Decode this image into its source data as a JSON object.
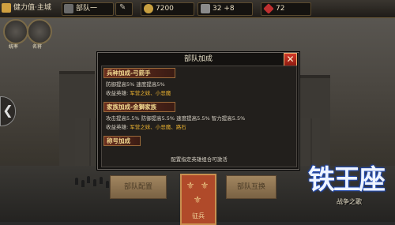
{
  "topbar": {
    "power_label": "健力值·主城",
    "unit_label": "部队一",
    "coins": "7200",
    "troops": "32",
    "troops_plus": "+8",
    "gems": "72"
  },
  "side": {
    "label_1": "统率",
    "label_2": "名将"
  },
  "modal": {
    "title": "部队加成",
    "close_glyph": "✕",
    "sections": [
      {
        "header": "兵种加成-弓箭手",
        "lines": [
          {
            "text": "防御提高5%  速度提高5%"
          },
          {
            "prefix": "收益英雄:",
            "heroes": "军营之妹、小恶魔"
          }
        ]
      },
      {
        "header": "家族加成-金獅家族",
        "lines": [
          {
            "text": "攻击提高5.5%  防御提高5.5%  速度提高5.5%  智力提高5.5%"
          },
          {
            "prefix": "收益英雄:",
            "heroes": "军营之妹、小恶魔、路石"
          }
        ]
      },
      {
        "header": "称号加成",
        "lines": []
      }
    ],
    "footer": "配置指定英雄组合可激活"
  },
  "buttons": {
    "left": "部队配置",
    "center": "征兵",
    "right": "部队互换"
  },
  "logo": {
    "title": "铁王座",
    "subtitle": "战争之歌"
  },
  "left_arrow": "❮"
}
